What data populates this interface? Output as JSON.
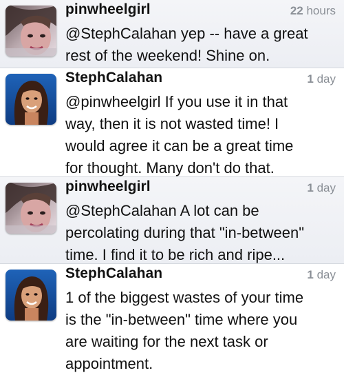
{
  "tweets": [
    {
      "username": "pinwheelgirl",
      "time_value": "22",
      "time_unit": "hours",
      "text": "@StephCalahan yep -- have a great\nrest of the weekend! Shine on.",
      "avatar": "pinwheelgirl-avatar"
    },
    {
      "username": "StephCalahan",
      "time_value": "1",
      "time_unit": "day",
      "text": "@pinwheelgirl If you use it in that\nway, then it is not wasted time!  I\nwould agree it can be a great time\nfor thought. Many don't do that.",
      "avatar": "stephcalahan-avatar"
    },
    {
      "username": "pinwheelgirl",
      "time_value": "1",
      "time_unit": "day",
      "text": "@StephCalahan A lot can be\npercolating during that \"in-between\"\ntime. I find it to be rich and ripe...",
      "avatar": "pinwheelgirl-avatar"
    },
    {
      "username": "StephCalahan",
      "time_value": "1",
      "time_unit": "day",
      "text": "1 of the biggest wastes of your time\nis the \"in-between\" time where you\nare waiting for the next task or\nappointment.",
      "avatar": "stephcalahan-avatar"
    }
  ]
}
